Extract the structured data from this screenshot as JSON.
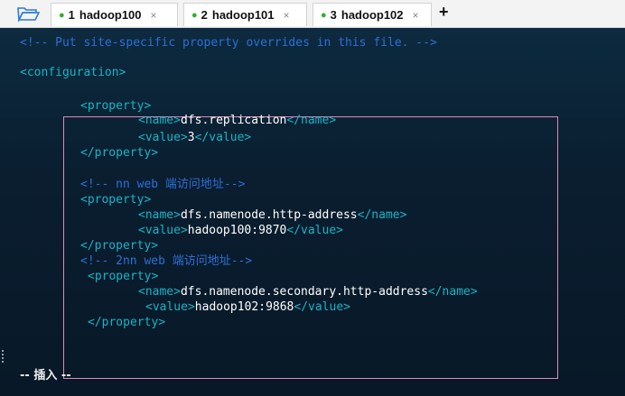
{
  "tabs": [
    {
      "index": "1",
      "label": "hadoop100",
      "close": "×"
    },
    {
      "index": "2",
      "label": "hadoop101",
      "close": "×"
    },
    {
      "index": "3",
      "label": "hadoop102",
      "close": "×"
    }
  ],
  "new_tab": "+",
  "editor": {
    "l1": "<!-- Put site-specific property overrides in this file. -->",
    "l2": "<configuration>",
    "p1_open": "<property>",
    "p1_name_open": "<name>",
    "p1_name_val": "dfs.replication",
    "p1_name_close": "</name>",
    "p1_value_open": "<value>",
    "p1_value_val": "3",
    "p1_value_close": "</value>",
    "p1_close": "</property>",
    "c2": "<!-- nn web 端访问地址-->",
    "p2_open": "<property>",
    "p2_name_open": "<name>",
    "p2_name_val": "dfs.namenode.http-address",
    "p2_name_close": "</name>",
    "p2_value_open": "<value>",
    "p2_value_val": "hadoop100:9870",
    "p2_value_close": "</value>",
    "p2_close": "</property>",
    "c3": "<!-- 2nn web 端访问地址-->",
    "p3_open": "<property>",
    "p3_name_open": "<name>",
    "p3_name_val": "dfs.namenode.secondary.http-address",
    "p3_name_close": "</name>",
    "p3_value_open": "<value>",
    "p3_value_val": "hadoop102:9868",
    "p3_value_close": "</value>",
    "p3_close": "</property>"
  },
  "status_mode": "-- 插入 --",
  "colors": {
    "comment": "#2d6fd6",
    "tag": "#17b5c6",
    "text": "#ffffff",
    "highlight_box": "#e089b7",
    "tab_dot": "#2db02d"
  }
}
